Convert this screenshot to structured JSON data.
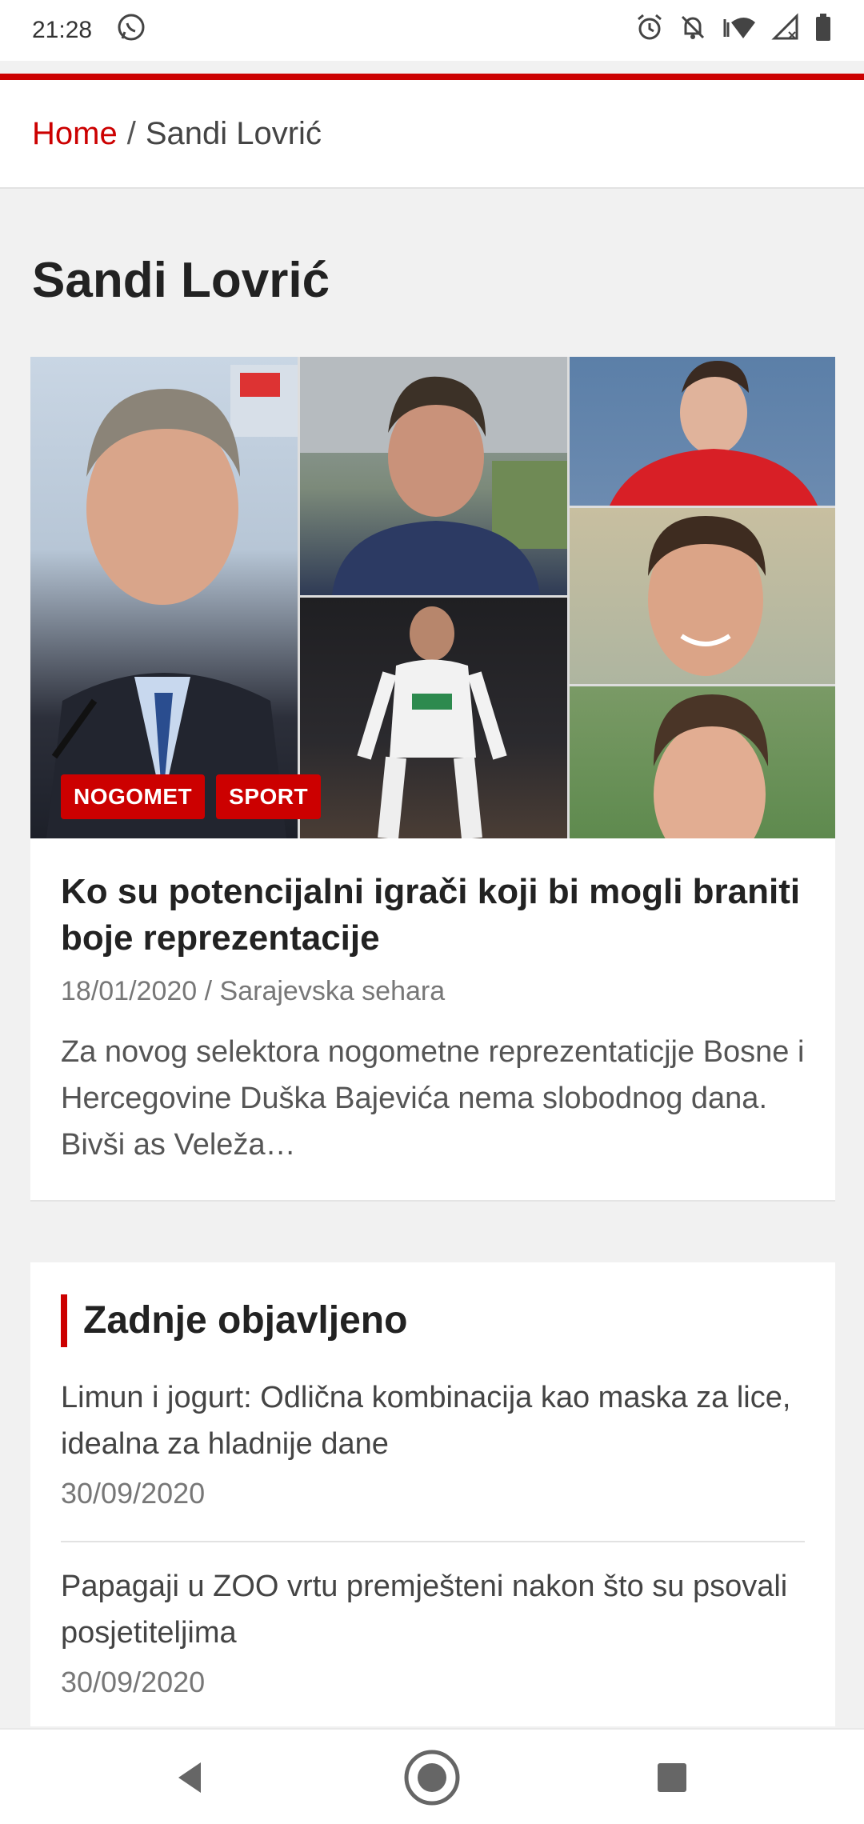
{
  "status_bar": {
    "time": "21:28",
    "icons": [
      "whatsapp-icon",
      "alarm-icon",
      "notifications-off-icon",
      "wifi-icon",
      "signal-icon",
      "battery-icon"
    ]
  },
  "breadcrumb": {
    "home": "Home",
    "separator": "/",
    "current": "Sandi Lovrić"
  },
  "page": {
    "title": "Sandi Lovrić"
  },
  "article": {
    "tags": [
      "NOGOMET",
      "SPORT"
    ],
    "title": "Ko su potencijalni igrači koji bi mogli braniti boje reprezentacije",
    "date": "18/01/2020",
    "meta_separator": "/",
    "author": "Sarajevska sehara",
    "excerpt": "Za novog selektora nogometne reprezentaticjje Bosne i Hercegovine Duška Bajevića nema slobodnog dana. Bivši as Veleža…"
  },
  "latest": {
    "heading": "Zadnje objavljeno",
    "items": [
      {
        "title": "Limun i jogurt: Odlična kombinacija kao maska za lice, idealna za hladnije dane",
        "date": "30/09/2020"
      },
      {
        "title": "Papagaji u ZOO vrtu premješteni nakon što su psovali posjetiteljima",
        "date": "30/09/2020"
      }
    ]
  },
  "colors": {
    "accent": "#cc0000",
    "background": "#f1f1f1",
    "card": "#ffffff"
  },
  "nav": {
    "icons": [
      "back-icon",
      "home-icon",
      "recents-icon"
    ]
  }
}
